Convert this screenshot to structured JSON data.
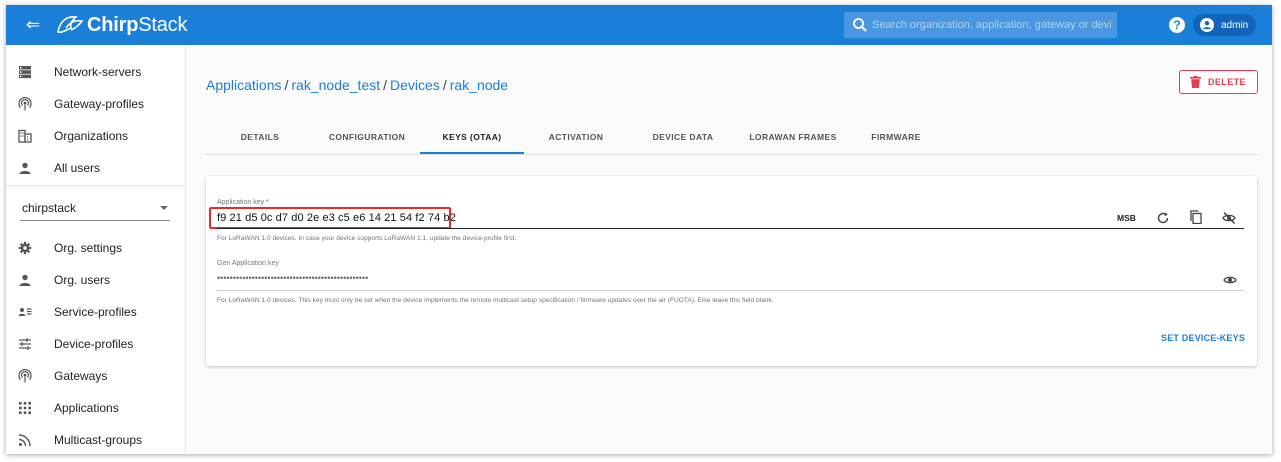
{
  "header": {
    "logo_bold": "Chirp",
    "logo_light": "Stack",
    "search_placeholder": "Search organization, application, gateway or device",
    "help_label": "?",
    "user_name": "admin",
    "accent_color": "#1a7fd9"
  },
  "sidebar": {
    "global_items": [
      {
        "label": "Network-servers",
        "icon": "server-icon"
      },
      {
        "label": "Gateway-profiles",
        "icon": "wifi-tethering-icon"
      },
      {
        "label": "Organizations",
        "icon": "domain-icon"
      },
      {
        "label": "All users",
        "icon": "person-icon"
      }
    ],
    "organization": "chirpstack",
    "org_items": [
      {
        "label": "Org. settings",
        "icon": "gear-icon"
      },
      {
        "label": "Org. users",
        "icon": "person-icon"
      },
      {
        "label": "Service-profiles",
        "icon": "account-details-icon"
      },
      {
        "label": "Device-profiles",
        "icon": "tune-icon"
      },
      {
        "label": "Gateways",
        "icon": "wifi-tethering-icon"
      },
      {
        "label": "Applications",
        "icon": "apps-icon"
      },
      {
        "label": "Multicast-groups",
        "icon": "rss-icon"
      }
    ]
  },
  "breadcrumb": {
    "items": [
      "Applications",
      "rak_node_test",
      "Devices",
      "rak_node"
    ],
    "separator": "/"
  },
  "actions": {
    "delete_label": "DELETE",
    "delete_color": "#e33d4f"
  },
  "tabs": [
    {
      "label": "DETAILS",
      "active": false
    },
    {
      "label": "CONFIGURATION",
      "active": false
    },
    {
      "label": "KEYS (OTAA)",
      "active": true
    },
    {
      "label": "ACTIVATION",
      "active": false
    },
    {
      "label": "DEVICE DATA",
      "active": false
    },
    {
      "label": "LORAWAN FRAMES",
      "active": false
    },
    {
      "label": "FIRMWARE",
      "active": false
    }
  ],
  "keys_form": {
    "app_key_label": "Application key *",
    "app_key_value": "f9 21 d5 0c d7 d0 2e e3 c5 e6 14 21 54 f2 74 b2",
    "byte_order": "MSB",
    "app_key_helper": "For LoRaWAN 1.0 devices. In case your device supports LoRaWAN 1.1, update the device-profile first.",
    "gen_key_label": "Gen Application key",
    "gen_key_value": "••••••••••••••••••••••••••••••••••••••••••••••••",
    "gen_key_helper": "For LoRaWAN 1.0 devices. This key must only be set when the device implements the remote multicast setup specification / firmware updates over the air (FUOTA). Else leave this field blank.",
    "submit_label": "SET DEVICE-KEYS",
    "highlight_color": "#e52b2b"
  }
}
